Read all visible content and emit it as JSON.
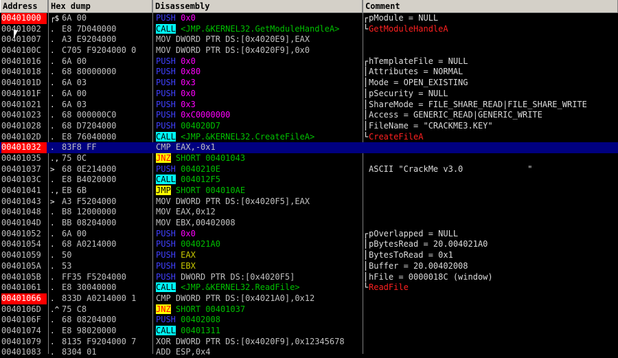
{
  "columns": {
    "address": "Address",
    "hex": "Hex dump",
    "disasm": "Disassembly",
    "comment": "Comment"
  },
  "rows": [
    {
      "addr": "00401000",
      "bp": true,
      "arrow": "┌$",
      "hex": "6A 00",
      "mn": "PUSH",
      "mnClass": "push",
      "op": "0x0",
      "opClass": "magenta",
      "brk": "┌",
      "cmt": "pModule = NULL"
    },
    {
      "addr": "00401002",
      "arrow": ".",
      "hex": "E8 7D040000",
      "mn": "CALL",
      "mnClass": "call",
      "op": "<JMP.&KERNEL32.GetModuleHandleA>",
      "opClass": "green",
      "brk": "└",
      "cmt": "GetModuleHandleA",
      "cmtRed": true
    },
    {
      "addr": "00401007",
      "arrow": ".",
      "hex": "A3 E9204000",
      "mn": "MOV",
      "mnClass": "plain",
      "op": "DWORD PTR DS:[0x4020E9],EAX",
      "opClass": "white"
    },
    {
      "addr": "0040100C",
      "arrow": ".",
      "hex": "C705 F9204000 0",
      "mn": "MOV",
      "mnClass": "plain",
      "op": "DWORD PTR DS:[0x4020F9],0x0",
      "opClass": "white"
    },
    {
      "addr": "00401016",
      "arrow": ".",
      "hex": "6A 00",
      "mn": "PUSH",
      "mnClass": "push",
      "op": "0x0",
      "opClass": "magenta",
      "brk": "┌",
      "cmt": "hTemplateFile = NULL"
    },
    {
      "addr": "00401018",
      "arrow": ".",
      "hex": "68 80000000",
      "mn": "PUSH",
      "mnClass": "push",
      "op": "0x80",
      "opClass": "magenta",
      "brk": "│",
      "cmt": "Attributes = NORMAL"
    },
    {
      "addr": "0040101D",
      "arrow": ".",
      "hex": "6A 03",
      "mn": "PUSH",
      "mnClass": "push",
      "op": "0x3",
      "opClass": "magenta",
      "brk": "│",
      "cmt": "Mode = OPEN_EXISTING"
    },
    {
      "addr": "0040101F",
      "arrow": ".",
      "hex": "6A 00",
      "mn": "PUSH",
      "mnClass": "push",
      "op": "0x0",
      "opClass": "magenta",
      "brk": "│",
      "cmt": "pSecurity = NULL"
    },
    {
      "addr": "00401021",
      "arrow": ".",
      "hex": "6A 03",
      "mn": "PUSH",
      "mnClass": "push",
      "op": "0x3",
      "opClass": "magenta",
      "brk": "│",
      "cmt": "ShareMode = FILE_SHARE_READ|FILE_SHARE_WRITE"
    },
    {
      "addr": "00401023",
      "arrow": ".",
      "hex": "68 000000C0",
      "mn": "PUSH",
      "mnClass": "push",
      "op": "0xC0000000",
      "opClass": "magenta",
      "brk": "│",
      "cmt": "Access = GENERIC_READ|GENERIC_WRITE"
    },
    {
      "addr": "00401028",
      "arrow": ".",
      "hex": "68 D7204000",
      "mn": "PUSH",
      "mnClass": "push",
      "op": "004020D7",
      "opClass": "green",
      "brk": "│",
      "cmt": "FileName = \"CRACKME3.KEY\""
    },
    {
      "addr": "0040102D",
      "arrow": ".",
      "hex": "E8 76040000",
      "mn": "CALL",
      "mnClass": "call",
      "op": "<JMP.&KERNEL32.CreateFileA>",
      "opClass": "green",
      "brk": "└",
      "cmt": "CreateFileA",
      "cmtRed": true
    },
    {
      "addr": "00401032",
      "bp": true,
      "sel": true,
      "arrow": ".",
      "hex": "83F8 FF",
      "mn": "CMP",
      "mnClass": "plain",
      "op": "EAX,-0x1",
      "opClass": "white"
    },
    {
      "addr": "00401035",
      "arrow": ".,",
      "hex": "75 0C",
      "mn": "JNZ",
      "mnClass": "jnz",
      "op": "SHORT 00401043",
      "opClass": "green"
    },
    {
      "addr": "00401037",
      "arrow": ">",
      "hex": "68 0E214000",
      "mn": "PUSH",
      "mnClass": "push",
      "op": "0040210E",
      "opClass": "green",
      "cmt": "ASCII \"CrackMe v3.0             \""
    },
    {
      "addr": "0040103C",
      "arrow": ".",
      "hex": "E8 B4020000",
      "mn": "CALL",
      "mnClass": "call",
      "op": "004012F5",
      "opClass": "green"
    },
    {
      "addr": "00401041",
      "arrow": ".,",
      "hex": "EB 6B",
      "mn": "JMP",
      "mnClass": "jmp",
      "op": "SHORT 004010AE",
      "opClass": "green"
    },
    {
      "addr": "00401043",
      "arrow": ">",
      "hex": "A3 F5204000",
      "mn": "MOV",
      "mnClass": "plain",
      "op": "DWORD PTR DS:[0x4020F5],EAX",
      "opClass": "white"
    },
    {
      "addr": "00401048",
      "arrow": ".",
      "hex": "B8 12000000",
      "mn": "MOV",
      "mnClass": "plain",
      "op": "EAX,0x12",
      "opClass": "white"
    },
    {
      "addr": "0040104D",
      "arrow": ".",
      "hex": "BB 08204000",
      "mn": "MOV",
      "mnClass": "plain",
      "op": "EBX,00402008",
      "opClass": "white"
    },
    {
      "addr": "00401052",
      "arrow": ".",
      "hex": "6A 00",
      "mn": "PUSH",
      "mnClass": "push",
      "op": "0x0",
      "opClass": "magenta",
      "brk": "┌",
      "cmt": "pOverlapped = NULL"
    },
    {
      "addr": "00401054",
      "arrow": ".",
      "hex": "68 A0214000",
      "mn": "PUSH",
      "mnClass": "push",
      "op": "004021A0",
      "opClass": "green",
      "brk": "│",
      "cmt": "pBytesRead = 20.004021A0"
    },
    {
      "addr": "00401059",
      "arrow": ".",
      "hex": "50",
      "mn": "PUSH",
      "mnClass": "push",
      "op": "EAX",
      "opClass": "yellow",
      "brk": "│",
      "cmt": "BytesToRead = 0x1"
    },
    {
      "addr": "0040105A",
      "arrow": ".",
      "hex": "53",
      "mn": "PUSH",
      "mnClass": "push",
      "op": "EBX",
      "opClass": "yellow",
      "brk": "│",
      "cmt": "Buffer = 20.00402008"
    },
    {
      "addr": "0040105B",
      "arrow": ".",
      "hex": "FF35 F5204000",
      "mn": "PUSH",
      "mnClass": "push",
      "op": "DWORD PTR DS:[0x4020F5]",
      "opClass": "white",
      "brk": "│",
      "cmt": "hFile = 0000018C (window)"
    },
    {
      "addr": "00401061",
      "arrow": ".",
      "hex": "E8 30040000",
      "mn": "CALL",
      "mnClass": "call",
      "op": "<JMP.&KERNEL32.ReadFile>",
      "opClass": "green",
      "brk": "└",
      "cmt": "ReadFile",
      "cmtRed": true
    },
    {
      "addr": "00401066",
      "bp": true,
      "arrow": ".",
      "hex": "833D A0214000 1",
      "mn": "CMP",
      "mnClass": "plain",
      "op": "DWORD PTR DS:[0x4021A0],0x12",
      "opClass": "white"
    },
    {
      "addr": "0040106D",
      "arrow": ".^",
      "hex": "75 C8",
      "mn": "JNZ",
      "mnClass": "jnz",
      "op": "SHORT 00401037",
      "opClass": "green"
    },
    {
      "addr": "0040106F",
      "arrow": ".",
      "hex": "68 08204000",
      "mn": "PUSH",
      "mnClass": "push",
      "op": "00402008",
      "opClass": "green"
    },
    {
      "addr": "00401074",
      "arrow": ".",
      "hex": "E8 98020000",
      "mn": "CALL",
      "mnClass": "call",
      "op": "00401311",
      "opClass": "green"
    },
    {
      "addr": "00401079",
      "arrow": ".",
      "hex": "8135 F9204000 7",
      "mn": "XOR",
      "mnClass": "plain",
      "op": "DWORD PTR DS:[0x4020F9],0x12345678",
      "opClass": "white"
    },
    {
      "addr": "00401083",
      "arrow": ".",
      "hex": "8304 01",
      "mn": "ADD",
      "mnClass": "plain",
      "op": "ESP,0x4",
      "opClass": "white"
    }
  ]
}
